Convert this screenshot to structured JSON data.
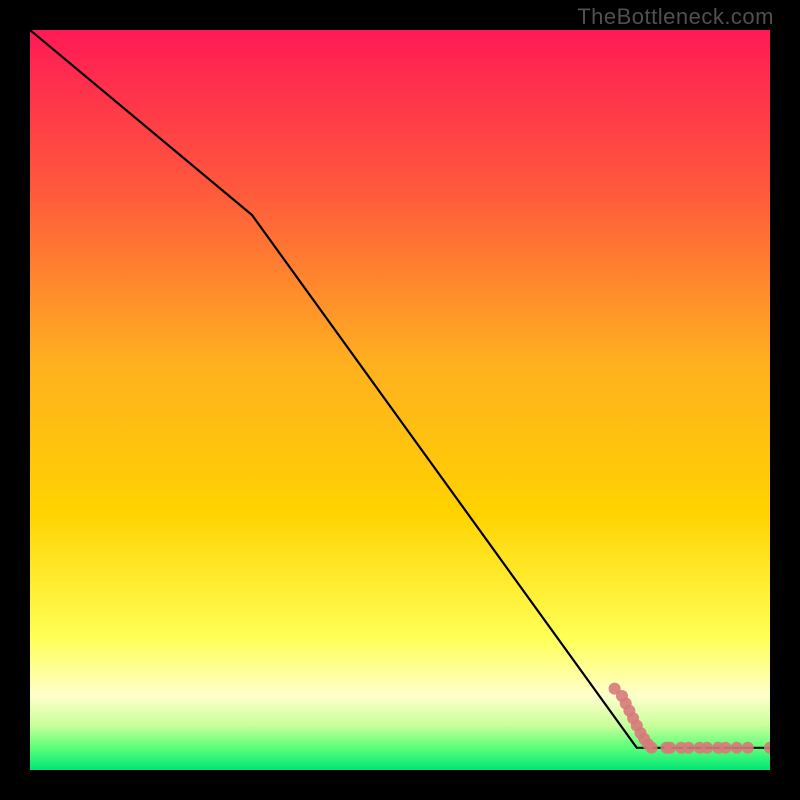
{
  "watermark": "TheBottleneck.com",
  "colors": {
    "bg": "#000000",
    "gradient_top": "#ff1a55",
    "gradient_mid_upper": "#ff7a2a",
    "gradient_mid": "#ffd200",
    "gradient_mid_lower": "#ffff66",
    "gradient_lower_yellow": "#ffffaa",
    "gradient_green_light": "#8bff6b",
    "gradient_green": "#00e676",
    "line": "#000000",
    "marker": "#d77a7a"
  },
  "chart_data": {
    "type": "line",
    "xlabel": "",
    "ylabel": "",
    "xlim": [
      0,
      100
    ],
    "ylim": [
      0,
      100
    ],
    "series": [
      {
        "name": "curve",
        "x": [
          0,
          30,
          82,
          100
        ],
        "y": [
          100,
          75,
          3,
          3
        ]
      }
    ],
    "markers": {
      "name": "points",
      "color": "#d77a7a",
      "points": [
        {
          "x": 79,
          "y": 11
        },
        {
          "x": 80,
          "y": 10
        },
        {
          "x": 80.5,
          "y": 9
        },
        {
          "x": 81,
          "y": 8
        },
        {
          "x": 81.5,
          "y": 7
        },
        {
          "x": 82,
          "y": 6
        },
        {
          "x": 82.5,
          "y": 5
        },
        {
          "x": 83,
          "y": 4.2
        },
        {
          "x": 83.5,
          "y": 3.5
        },
        {
          "x": 84,
          "y": 3
        },
        {
          "x": 86,
          "y": 3
        },
        {
          "x": 86.5,
          "y": 3
        },
        {
          "x": 88,
          "y": 3
        },
        {
          "x": 89,
          "y": 3
        },
        {
          "x": 90.5,
          "y": 3
        },
        {
          "x": 91.5,
          "y": 3
        },
        {
          "x": 93,
          "y": 3
        },
        {
          "x": 94,
          "y": 3
        },
        {
          "x": 95.5,
          "y": 3
        },
        {
          "x": 97,
          "y": 3
        },
        {
          "x": 100,
          "y": 3
        }
      ]
    }
  }
}
